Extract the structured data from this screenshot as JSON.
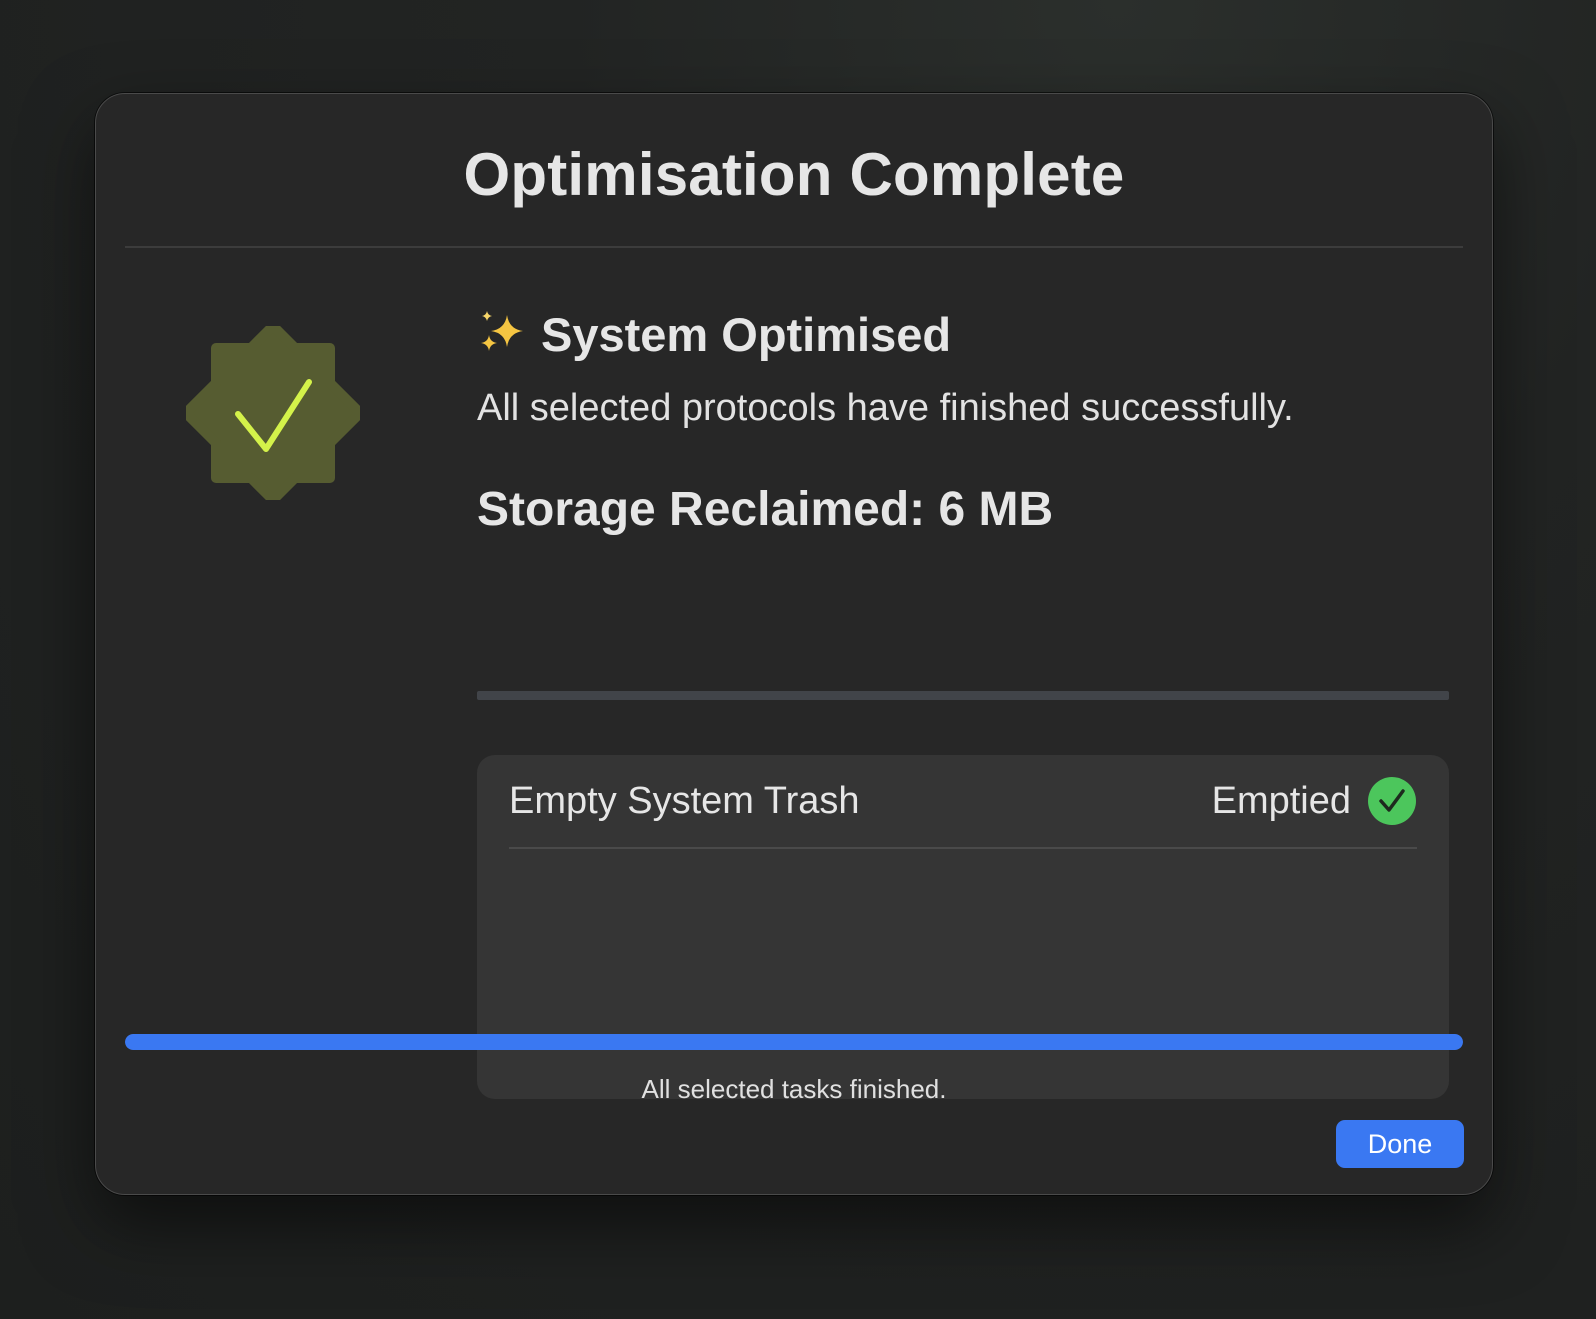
{
  "dialog": {
    "title": "Optimisation Complete"
  },
  "summary": {
    "badge_icon": "checkmark-seal-icon",
    "sparkle_icon": "sparkles-icon",
    "headline": "System Optimised",
    "subtext": "All selected protocols have finished successfully.",
    "storage_reclaimed": "Storage Reclaimed: 6 MB"
  },
  "tasks": [
    {
      "name": "Empty System Trash",
      "status": "Emptied",
      "status_icon": "checkmark-circle-icon"
    }
  ],
  "progress": {
    "fraction": 1.0,
    "status_text": "All selected tasks finished."
  },
  "buttons": {
    "done_label": "Done"
  },
  "colors": {
    "accent_blue": "#3a78f2",
    "success_green": "#4cc65c",
    "badge_fill": "#565c31",
    "badge_check": "#d4f24a"
  }
}
